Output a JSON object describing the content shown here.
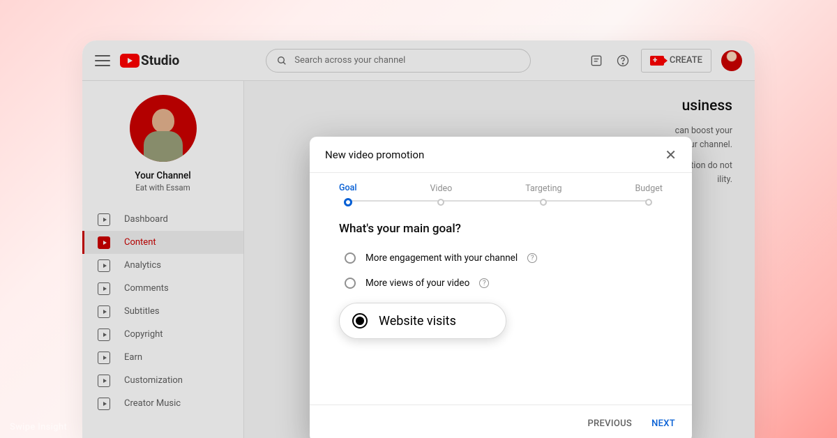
{
  "header": {
    "logo_text": "Studio",
    "search_placeholder": "Search across your channel",
    "create_label": "CREATE"
  },
  "sidebar": {
    "channel_name": "Your Channel",
    "channel_sub": "Eat with Essam",
    "items": [
      {
        "label": "Dashboard"
      },
      {
        "label": "Content"
      },
      {
        "label": "Analytics"
      },
      {
        "label": "Comments"
      },
      {
        "label": "Subtitles"
      },
      {
        "label": "Copyright"
      },
      {
        "label": "Earn"
      },
      {
        "label": "Customization"
      },
      {
        "label": "Creator Music"
      }
    ]
  },
  "main": {
    "headline_suffix": "usiness",
    "para1_suffix1": "can boost your",
    "para1_suffix2": "th your channel.",
    "para2_suffix1": "motion do not",
    "para2_suffix2": "ility."
  },
  "modal": {
    "title": "New video promotion",
    "steps": [
      "Goal",
      "Video",
      "Targeting",
      "Budget"
    ],
    "question": "What's your main goal?",
    "options": [
      {
        "label": "More engagement with your channel",
        "selected": false,
        "help": true
      },
      {
        "label": "More views of your video",
        "selected": false,
        "help": true
      },
      {
        "label": "Website visits",
        "selected": true,
        "help": false
      }
    ],
    "prev": "PREVIOUS",
    "next": "NEXT"
  },
  "watermark": "Swipe Insight"
}
